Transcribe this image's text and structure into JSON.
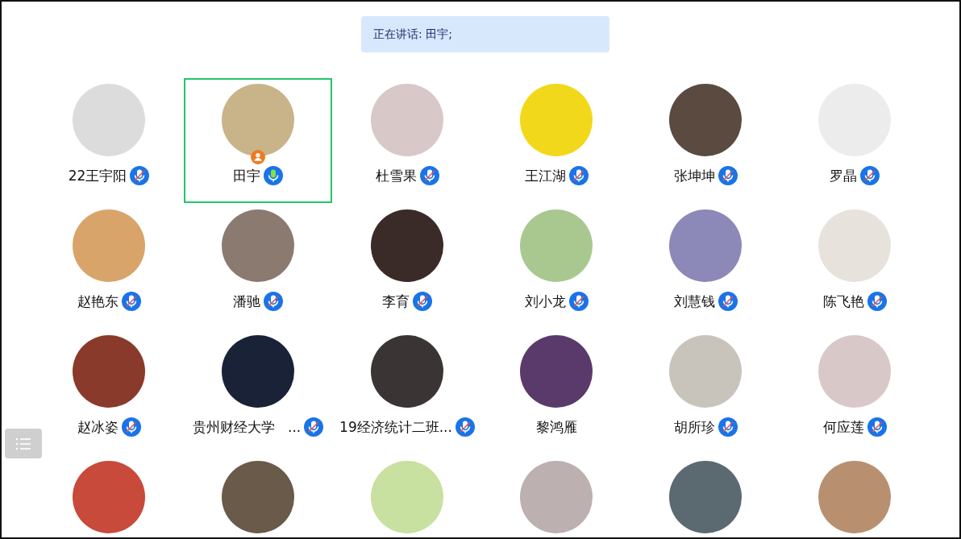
{
  "speaking_banner": {
    "label": "正在讲话:",
    "speakers": "田宇;"
  },
  "participants": [
    {
      "name": "22王宇阳",
      "mic_shown": true,
      "muted": true,
      "selected": false,
      "host": false
    },
    {
      "name": "田宇",
      "mic_shown": true,
      "muted": false,
      "selected": true,
      "host": true
    },
    {
      "name": "杜雪果",
      "mic_shown": true,
      "muted": true,
      "selected": false,
      "host": false
    },
    {
      "name": "王江湖",
      "mic_shown": true,
      "muted": true,
      "selected": false,
      "host": false
    },
    {
      "name": "张坤坤",
      "mic_shown": true,
      "muted": true,
      "selected": false,
      "host": false
    },
    {
      "name": "罗晶",
      "mic_shown": true,
      "muted": true,
      "selected": false,
      "host": false
    },
    {
      "name": "赵艳东",
      "mic_shown": true,
      "muted": true,
      "selected": false,
      "host": false
    },
    {
      "name": "潘驰",
      "mic_shown": true,
      "muted": true,
      "selected": false,
      "host": false
    },
    {
      "name": "李育",
      "mic_shown": true,
      "muted": true,
      "selected": false,
      "host": false
    },
    {
      "name": "刘小龙",
      "mic_shown": true,
      "muted": true,
      "selected": false,
      "host": false
    },
    {
      "name": "刘慧钱",
      "mic_shown": true,
      "muted": true,
      "selected": false,
      "host": false
    },
    {
      "name": "陈飞艳",
      "mic_shown": true,
      "muted": true,
      "selected": false,
      "host": false
    },
    {
      "name": "赵冰姿",
      "mic_shown": true,
      "muted": true,
      "selected": false,
      "host": false
    },
    {
      "name": "贵州财经大学   ...",
      "mic_shown": true,
      "muted": true,
      "selected": false,
      "host": false
    },
    {
      "name": "19经济统计二班...",
      "mic_shown": true,
      "muted": true,
      "selected": false,
      "host": false
    },
    {
      "name": "黎鸿雁",
      "mic_shown": false,
      "selected": false,
      "host": false
    },
    {
      "name": "胡所珍",
      "mic_shown": true,
      "muted": true,
      "selected": false,
      "host": false
    },
    {
      "name": "何应莲",
      "mic_shown": true,
      "muted": true,
      "selected": false,
      "host": false
    },
    {
      "selected": false
    },
    {
      "selected": false
    },
    {
      "selected": false
    },
    {
      "selected": false
    },
    {
      "selected": false
    },
    {
      "selected": false
    }
  ]
}
